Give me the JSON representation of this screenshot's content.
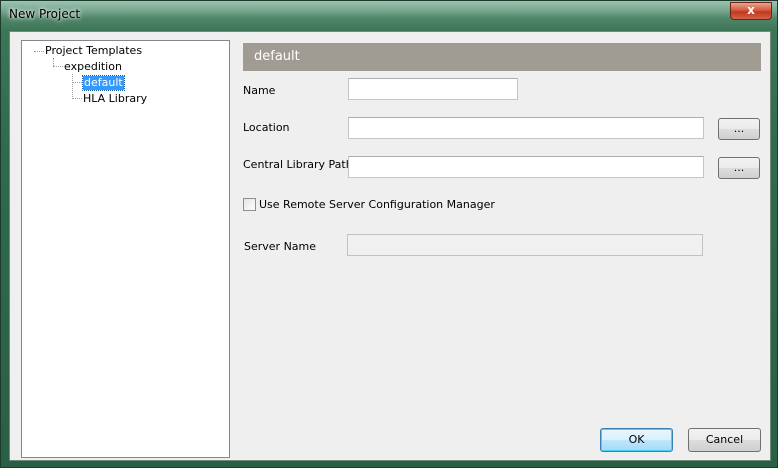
{
  "window": {
    "title": "New Project",
    "close_glyph": "x"
  },
  "tree": {
    "root": "Project Templates",
    "child": "expedition",
    "leaves": [
      "default",
      "HLA Library"
    ],
    "selected": "default"
  },
  "panel": {
    "header": "default",
    "name_label": "Name",
    "name_value": "",
    "location_label": "Location",
    "location_value": "",
    "browse_location_label": "...",
    "central_library_label": "Central Library Path",
    "central_library_value": "",
    "browse_library_label": "...",
    "remote_checkbox_label": "Use Remote Server Configuration Manager",
    "remote_checked": false,
    "server_name_label": "Server Name",
    "server_name_value": ""
  },
  "buttons": {
    "ok_label": "OK",
    "cancel_label": "Cancel"
  },
  "colors": {
    "header_band": "#a09c93",
    "selection": "#3399ff",
    "frame": "#2f6b4c"
  },
  "icons": {
    "close": "close-icon"
  }
}
